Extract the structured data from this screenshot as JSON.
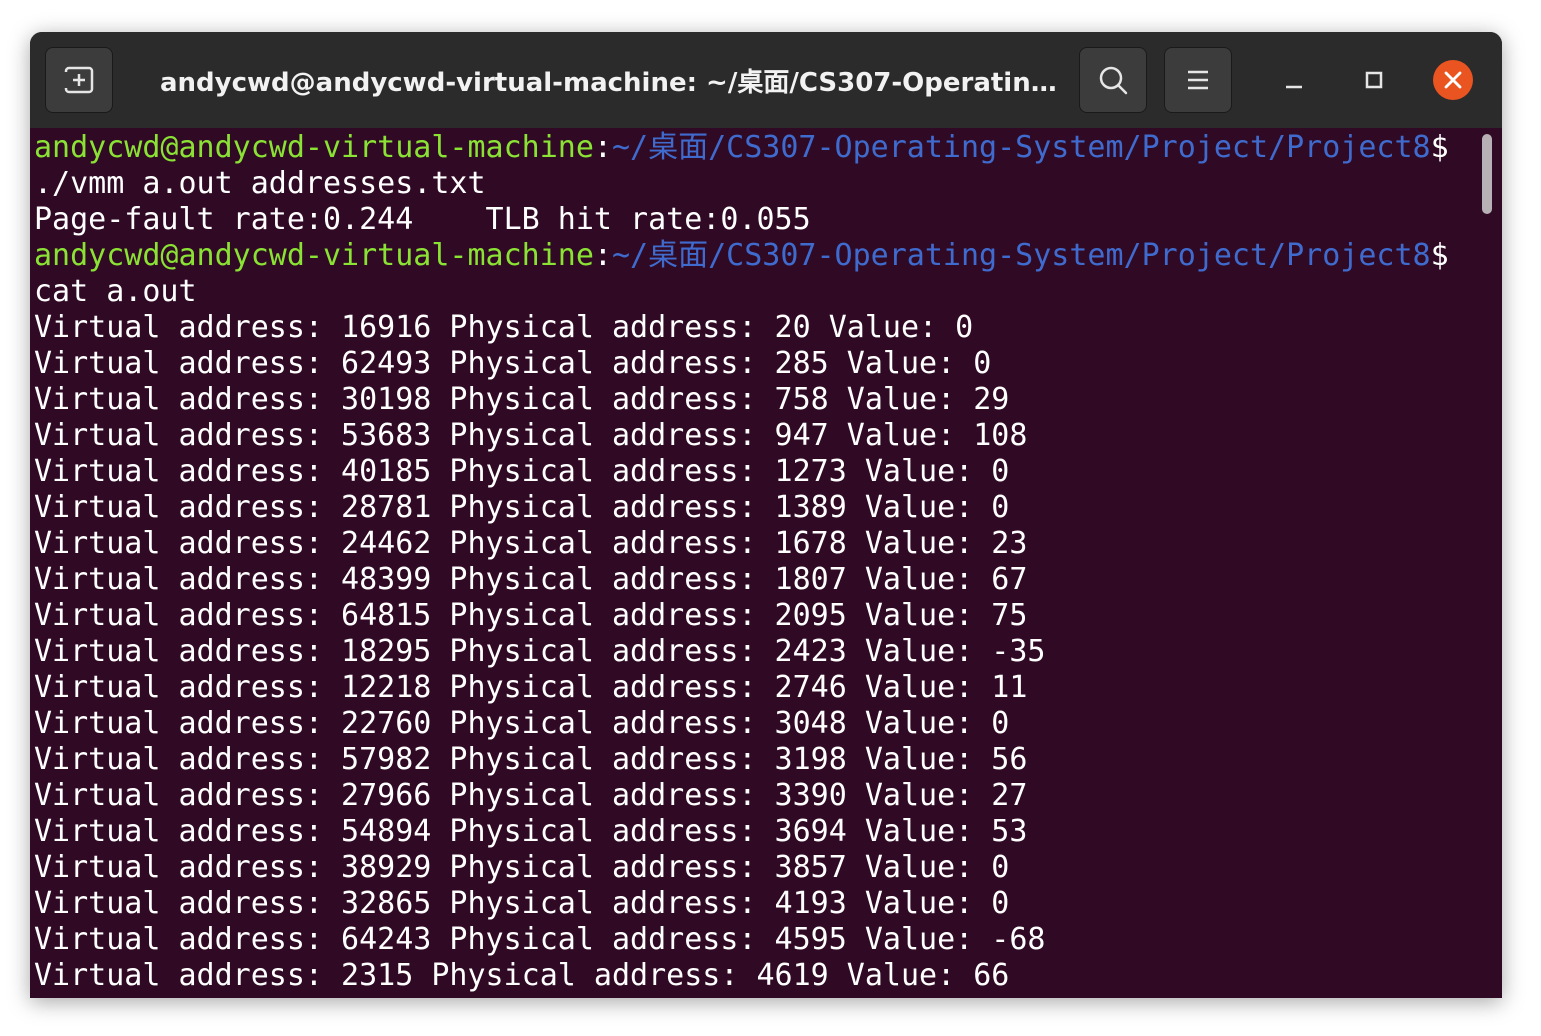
{
  "window": {
    "title": "andycwd@andycwd-virtual-machine: ~/桌面/CS307-Operatin…"
  },
  "colors": {
    "terminal_bg": "#300a24",
    "prompt_user": "#8ae234",
    "prompt_path": "#3f6bcf",
    "text": "#ffffff",
    "close_button": "#e95420"
  },
  "icons": {
    "new_tab": "new-tab-icon",
    "search": "search-icon",
    "menu": "hamburger-menu-icon",
    "minimize": "minimize-icon",
    "maximize": "maximize-icon",
    "close": "close-icon"
  },
  "terminal": {
    "prompt1": {
      "user": "andycwd@andycwd-virtual-machine",
      "sep": ":",
      "path": "~/桌面/CS307-Operating-System/Project/Project8",
      "symbol": "$"
    },
    "command1": "./vmm a.out addresses.txt",
    "result1": "Page-fault rate:0.244    TLB hit rate:0.055",
    "prompt2": {
      "user": "andycwd@andycwd-virtual-machine",
      "sep": ":",
      "path": "~/桌面/CS307-Operating-System/Project/Project8",
      "symbol": "$"
    },
    "command2": "cat a.out",
    "output": [
      "Virtual address: 16916 Physical address: 20 Value: 0",
      "Virtual address: 62493 Physical address: 285 Value: 0",
      "Virtual address: 30198 Physical address: 758 Value: 29",
      "Virtual address: 53683 Physical address: 947 Value: 108",
      "Virtual address: 40185 Physical address: 1273 Value: 0",
      "Virtual address: 28781 Physical address: 1389 Value: 0",
      "Virtual address: 24462 Physical address: 1678 Value: 23",
      "Virtual address: 48399 Physical address: 1807 Value: 67",
      "Virtual address: 64815 Physical address: 2095 Value: 75",
      "Virtual address: 18295 Physical address: 2423 Value: -35",
      "Virtual address: 12218 Physical address: 2746 Value: 11",
      "Virtual address: 22760 Physical address: 3048 Value: 0",
      "Virtual address: 57982 Physical address: 3198 Value: 56",
      "Virtual address: 27966 Physical address: 3390 Value: 27",
      "Virtual address: 54894 Physical address: 3694 Value: 53",
      "Virtual address: 38929 Physical address: 3857 Value: 0",
      "Virtual address: 32865 Physical address: 4193 Value: 0",
      "Virtual address: 64243 Physical address: 4595 Value: -68",
      "Virtual address: 2315 Physical address: 4619 Value: 66"
    ]
  }
}
